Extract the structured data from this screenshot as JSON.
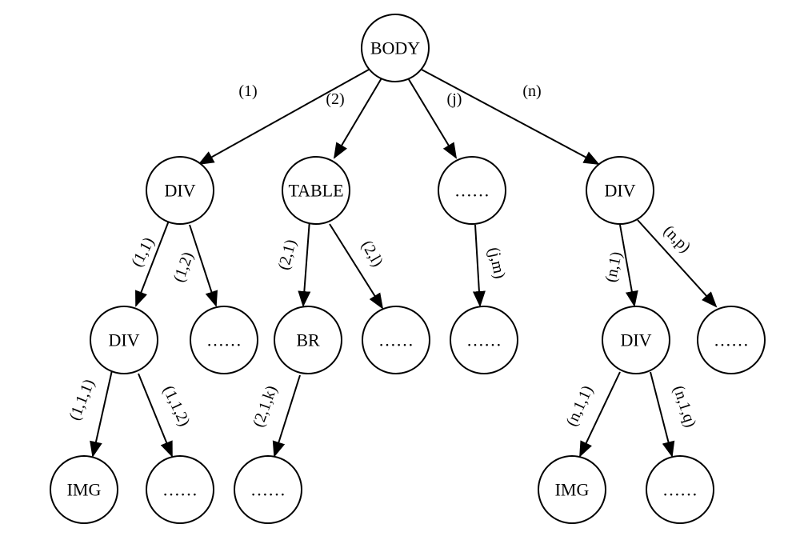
{
  "diagram": {
    "type": "tree",
    "description": "DOM Tree Structure",
    "nodes": {
      "root": "BODY",
      "l1_1": "DIV",
      "l1_2": "TABLE",
      "l1_3": "……",
      "l1_4": "DIV",
      "l2_1": "DIV",
      "l2_2": "……",
      "l2_3": "BR",
      "l2_4": "……",
      "l2_5": "……",
      "l2_6": "DIV",
      "l2_7": "……",
      "l3_1": "IMG",
      "l3_2": "……",
      "l3_3": "……",
      "l3_4": "IMG",
      "l3_5": "……"
    },
    "edges": {
      "e1": "(1)",
      "e2": "(2)",
      "e3": "(j)",
      "e4": "(n)",
      "e5": "(1,1)",
      "e6": "(1,2)",
      "e7": "(2,1)",
      "e8": "(2,l)",
      "e9": "(j,m)",
      "e10": "(n,1)",
      "e11": "(n,p)",
      "e12": "(1,1,1)",
      "e13": "(1,1,2)",
      "e14": "(2,1,k)",
      "e15": "(n,1,1)",
      "e16": "(n,1,q)"
    }
  }
}
